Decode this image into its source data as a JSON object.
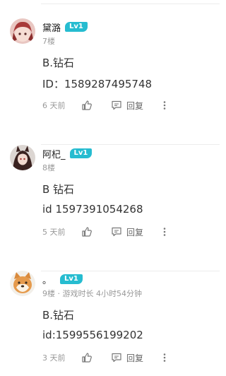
{
  "comments": [
    {
      "username": "黛潞",
      "level": "Lv1",
      "meta": "7楼",
      "line1": "B.钻石",
      "line2": "ID：1589287495748",
      "time": "6 天前",
      "reply_label": "回复"
    },
    {
      "username": "阿杞_",
      "level": "Lv1",
      "meta": "8楼",
      "line1": "B 钻石",
      "line2": "id 1597391054268",
      "time": "5 天前",
      "reply_label": "回复"
    },
    {
      "username": "。",
      "level": "Lv1",
      "meta": "9楼 · 游戏时长 4小时54分钟",
      "line1": "B.钻石",
      "line2": "id:1599556199202",
      "time": "3 天前",
      "reply_label": "回复"
    }
  ],
  "icons": {
    "like": "thumbs-up-icon",
    "reply": "comment-icon",
    "more": "more-vertical-icon"
  },
  "colors": {
    "badge": "#26bcd0",
    "meta": "#999999",
    "text": "#333333"
  }
}
